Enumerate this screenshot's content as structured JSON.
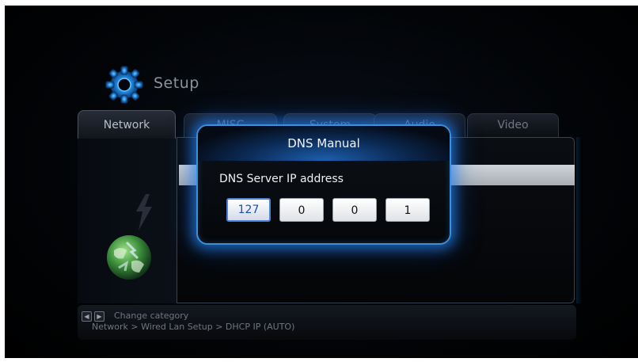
{
  "header": {
    "title": "Setup",
    "icon": "gear-icon"
  },
  "tabs": [
    {
      "label": "Network",
      "active": true
    },
    {
      "label": "MISC",
      "active": false
    },
    {
      "label": "System",
      "active": false
    },
    {
      "label": "Audio",
      "active": false
    },
    {
      "label": "Video",
      "active": false
    }
  ],
  "dialog": {
    "title": "DNS Manual",
    "subtitle": "DNS Server IP address",
    "octets": [
      "127",
      "0",
      "0",
      "1"
    ],
    "accent_color": "#3d8fd9"
  },
  "footer": {
    "change_category": "Change category",
    "breadcrumb": "Network > Wired Lan Setup > DHCP IP (AUTO)",
    "left_key_icon": "arrow-left-icon",
    "right_key_icon": "arrow-right-icon"
  },
  "icons": {
    "globe": "network-globe-icon",
    "lightning": "lightning-icon"
  }
}
